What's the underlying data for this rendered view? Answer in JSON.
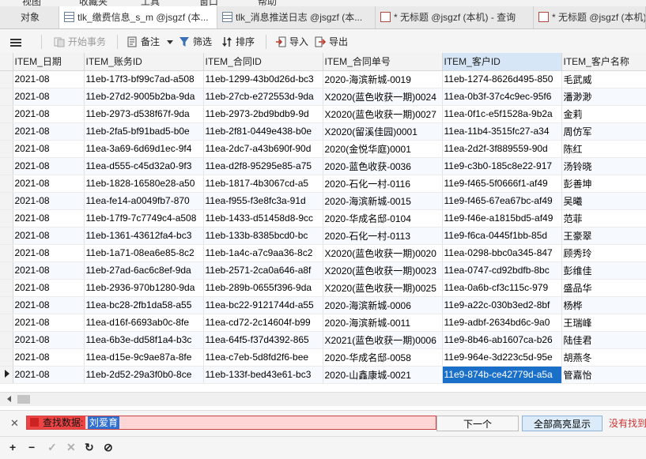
{
  "menu": {
    "items": [
      "视图",
      "收藏夹",
      "工具",
      "窗口",
      "帮助"
    ]
  },
  "tabs": [
    {
      "label": "对象",
      "active": false,
      "icon": "none"
    },
    {
      "label": "tlk_缴费信息_s_m @jsgzf (本...",
      "active": true,
      "icon": "table-icon"
    },
    {
      "label": "tlk_消息推送日志 @jsgzf (本...",
      "active": false,
      "icon": "table-icon"
    },
    {
      "label": "* 无标题 @jsgzf (本机) - 查询",
      "active": false,
      "icon": "query-icon"
    },
    {
      "label": "* 无标题 @jsgzf (本机) -",
      "active": false,
      "icon": "query-icon"
    }
  ],
  "toolbar": {
    "menu_icon": "hamburger-icon",
    "begin_transaction": "开始事务",
    "note": "备注",
    "filter": "筛选",
    "sort": "排序",
    "import": "导入",
    "export": "导出"
  },
  "columns": [
    "ITEM_日期",
    "ITEM_账务ID",
    "ITEM_合同ID",
    "ITEM_合同单号",
    "ITEM_客户ID",
    "ITEM_客户名称"
  ],
  "rows": [
    [
      "2021-08",
      "11eb-17f3-bf99c7ad-a508",
      "11eb-1299-43b0d26d-bc3",
      "2020-海滨新城-0019",
      "11eb-1274-8626d495-850",
      "毛武威"
    ],
    [
      "2021-08",
      "11eb-27d2-9005b2ba-9da",
      "11eb-27cb-e272553d-9da",
      "X2020(蓝色收获一期)0024",
      "11ea-0b3f-37c4c9ec-95f6",
      "潘渺渺"
    ],
    [
      "2021-08",
      "11eb-2973-d538f67f-9da",
      "11eb-2973-2bd9bdb9-9d",
      "X2020(蓝色收获一期)0027",
      "11ea-0f1c-e5f1528a-9b2a",
      "金莉"
    ],
    [
      "2021-08",
      "11eb-2fa5-bf91bad5-b0e",
      "11eb-2f81-0449e438-b0e",
      "X2020(留溪佳园)0001",
      "11ea-11b4-3515fc27-a34",
      "周仿军"
    ],
    [
      "2021-08",
      "11ea-3a69-6d69d1ec-9f4",
      "11ea-2dc7-a43b690f-90d",
      "2020(金悦华庭)0001",
      "11ea-2d2f-3f889559-90d",
      "陈红"
    ],
    [
      "2021-08",
      "11ea-d555-c45d32a0-9f3",
      "11ea-d2f8-95295e85-a75",
      "2020-蓝色收获-0036",
      "11e9-c3b0-185c8e22-917",
      "汤铃晓"
    ],
    [
      "2021-08",
      "11eb-1828-16580e28-a50",
      "11eb-1817-4b3067cd-a5",
      "2020-石化一村-0116",
      "11e9-f465-5f0666f1-af49",
      "彭善坤"
    ],
    [
      "2021-08",
      "11ea-fe14-a0049fb7-870",
      "11ea-f955-f3e8fc3a-91d",
      "2020-海滨新城-0015",
      "11e9-f465-67ea67bc-af49",
      "吴曦"
    ],
    [
      "2021-08",
      "11eb-17f9-7c7749c4-a508",
      "11eb-1433-d51458d8-9cc",
      "2020-华成名邸-0104",
      "11e9-f46e-a1815bd5-af49",
      "范菲"
    ],
    [
      "2021-08",
      "11eb-1361-43612fa4-bc3",
      "11eb-133b-8385bcd0-bc",
      "2020-石化一村-0113",
      "11e9-f6ca-0445f1bb-85d",
      "王豪翠"
    ],
    [
      "2021-08",
      "11eb-1a71-08ea6e85-8c2",
      "11eb-1a4c-a7c9aa36-8c2",
      "X2020(蓝色收获一期)0020",
      "11ea-0298-bbc0a345-847",
      "顾秀玲"
    ],
    [
      "2021-08",
      "11eb-27ad-6ac6c8ef-9da",
      "11eb-2571-2ca0a646-a8f",
      "X2020(蓝色收获一期)0023",
      "11ea-0747-cd92bdfb-8bc",
      "彭维佳"
    ],
    [
      "2021-08",
      "11eb-2936-970b1280-9da",
      "11eb-289b-0655f396-9da",
      "X2020(蓝色收获一期)0025",
      "11ea-0a6b-cf3c115c-979",
      "盛品华"
    ],
    [
      "2021-08",
      "11ea-bc28-2fb1da58-a55",
      "11ea-bc22-9121744d-a55",
      "2020-海滨新城-0006",
      "11e9-a22c-030b3ed2-8bf",
      "杨桦"
    ],
    [
      "2021-08",
      "11ea-d16f-6693ab0c-8fe",
      "11ea-cd72-2c14604f-b99",
      "2020-海滨新城-0011",
      "11e9-adbf-2634bd6c-9a0",
      "王瑞峰"
    ],
    [
      "2021-08",
      "11ea-6b3e-dd58f1a4-b3c",
      "11ea-64f5-f37d4392-865",
      "X2021(蓝色收获一期)0006",
      "11e9-8b46-ab1607ca-b26",
      "陆佳君"
    ],
    [
      "2021-08",
      "11ea-d15e-9c9ae87a-8fe",
      "11ea-c7eb-5d8fd2f6-bee",
      "2020-华成名邸-0058",
      "11e9-964e-3d223c5d-95e",
      "胡燕冬"
    ],
    [
      "2021-08",
      "11eb-2d52-29a3f0b0-8ce",
      "11eb-133f-bed43e61-bc3",
      "2020-山鑫康城-0021",
      "11e9-874b-ce42779d-a5a",
      "管嘉怡"
    ]
  ],
  "selected_row_index": 17,
  "highlighted_column": "ITEM_客户ID",
  "find": {
    "label": "查找数据:",
    "value": "刘爱育",
    "next": "下一个",
    "highlight_all": "全部高亮显示",
    "status": "没有找到"
  },
  "colors": {
    "selection": "#1a6fc9",
    "find_error_bg": "#ffd6d6",
    "status_red": "#d03030"
  }
}
